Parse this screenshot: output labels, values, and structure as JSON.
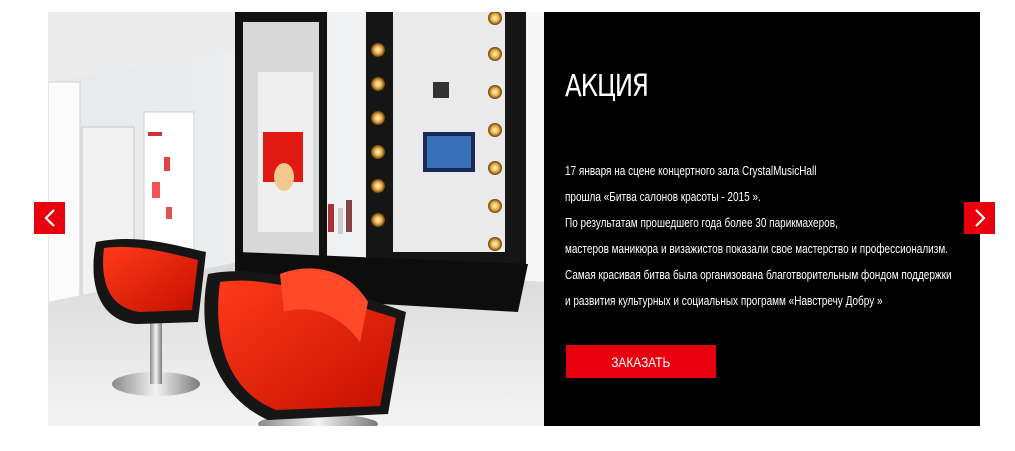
{
  "slide": {
    "title": "АКЦИЯ",
    "lines": [
      "17 января на сцене концертного зала CrystalMusicHall",
      "прошла  «Битва салонов красоты - 2015 ».",
      "По результатам прошедшего года более 30 парикмахеров,",
      "мастеров маникюра и визажистов показали свое мастерство и профессионализм.",
      "Самая красивая битва была организована благотворительным фондом поддержки",
      "и развития культурных и социальных программ «Навстречу Добру »"
    ],
    "button_label": "ЗАКАЗАТЬ"
  },
  "navigation": {
    "prev_icon": "chevron-left-icon",
    "next_icon": "chevron-right-icon"
  },
  "colors": {
    "accent": "#e8000f",
    "panel_background": "#000000",
    "panel_text": "#ffffff"
  }
}
